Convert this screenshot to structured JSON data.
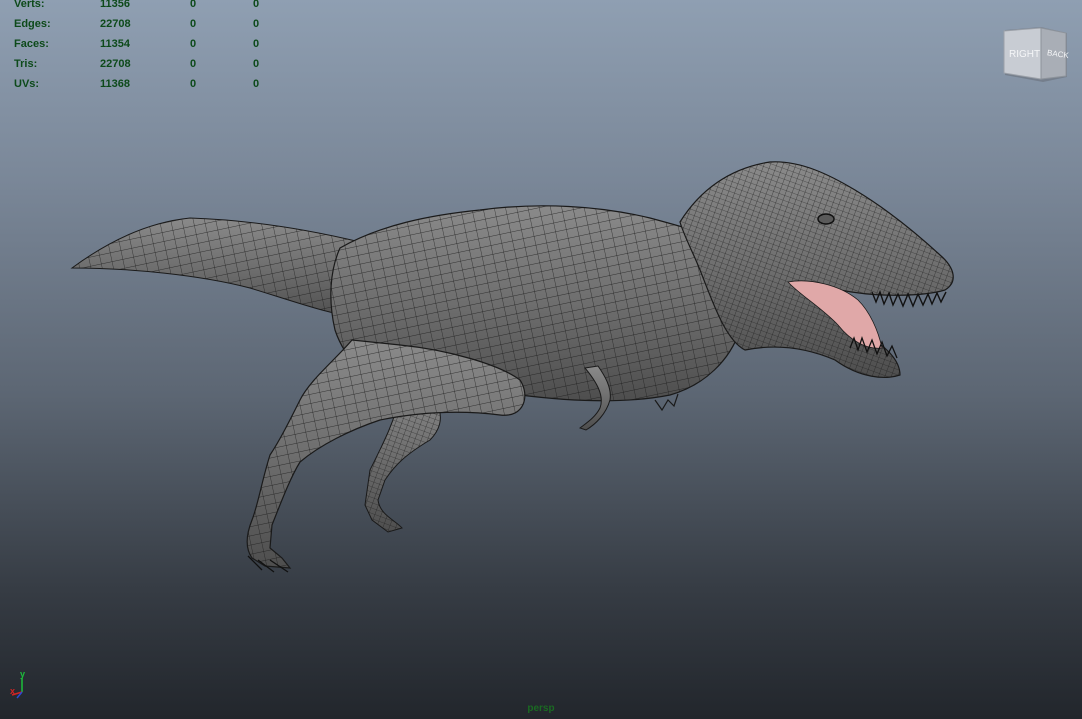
{
  "hud": {
    "rows": [
      {
        "label": "Verts:",
        "c1": "11356",
        "c2": "0",
        "c3": "0"
      },
      {
        "label": "Edges:",
        "c1": "22708",
        "c2": "0",
        "c3": "0"
      },
      {
        "label": "Faces:",
        "c1": "11354",
        "c2": "0",
        "c3": "0"
      },
      {
        "label": "Tris:",
        "c1": "22708",
        "c2": "0",
        "c3": "0"
      },
      {
        "label": "UVs:",
        "c1": "11368",
        "c2": "0",
        "c3": "0"
      }
    ]
  },
  "viewcube": {
    "right_label": "RIGHT",
    "back_label": "BACK"
  },
  "axis": {
    "y": "y",
    "x": "x"
  },
  "camera": {
    "name": "persp"
  },
  "colors": {
    "hud_text": "#0d4a1a",
    "mesh_fill": "#6f6f6f",
    "wireframe": "#1a1a1a",
    "mouth": "#e0a8a8",
    "camera_label": "#1a6a22"
  },
  "icons": {
    "viewcube": "viewcube-icon",
    "axis": "axis-gizmo-icon"
  }
}
